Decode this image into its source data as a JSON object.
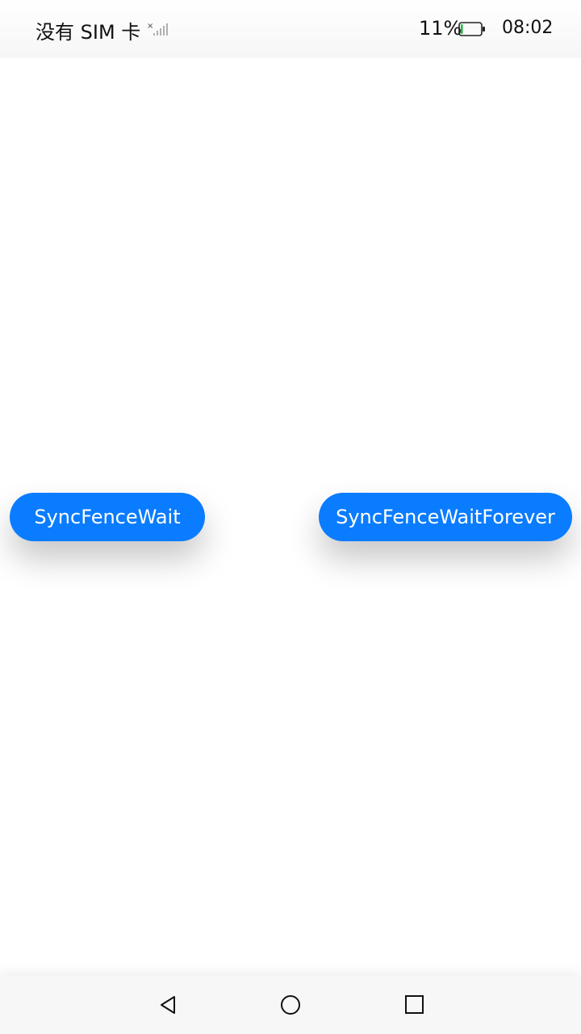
{
  "status_bar": {
    "carrier": "没有 SIM 卡",
    "signal_icon": "no-signal-icon",
    "battery_percent": "11%",
    "battery_level": 0.11,
    "battery_color": "#2db84d",
    "time": "08:02"
  },
  "main": {
    "buttons": [
      {
        "label": "SyncFenceWait"
      },
      {
        "label": "SyncFenceWaitForever"
      }
    ],
    "accent_color": "#0a7cff"
  },
  "nav_bar": {
    "back_icon": "back-triangle-icon",
    "home_icon": "home-circle-icon",
    "recent_icon": "recent-square-icon"
  }
}
